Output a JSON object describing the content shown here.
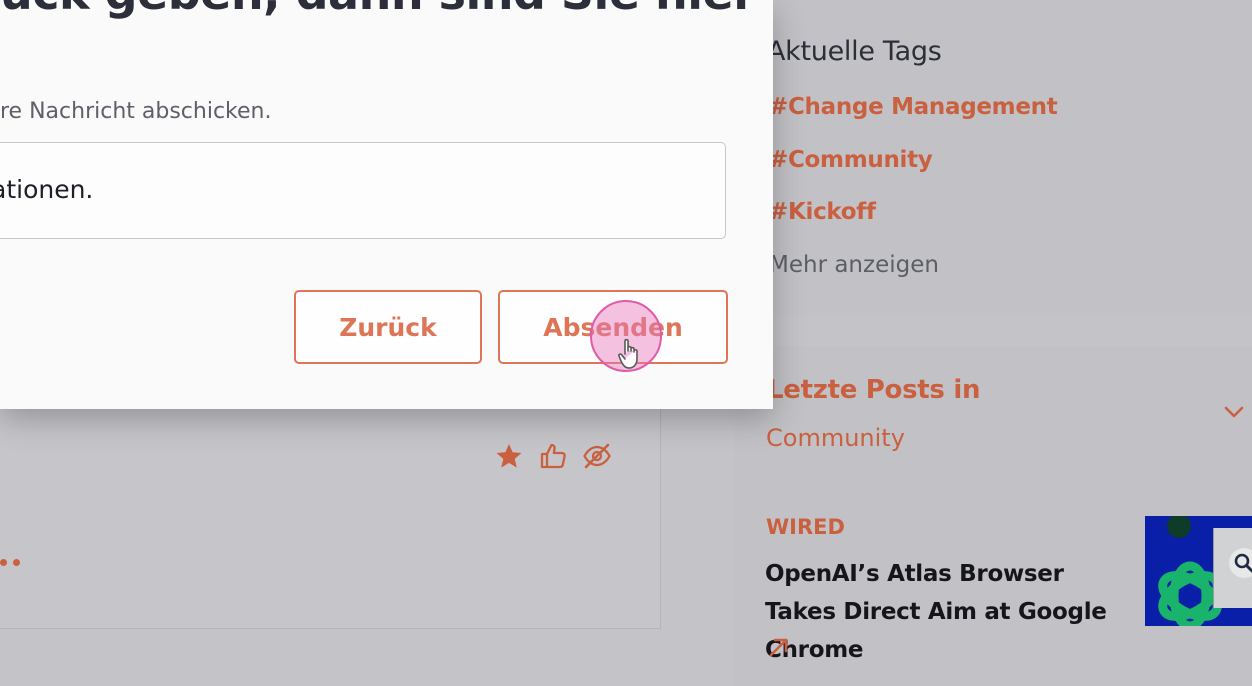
{
  "modal": {
    "heading": "ück geben, dann sind Sie hier",
    "description": "re Nachricht abschicken.",
    "input_value": "ationen.",
    "back_label": "Zurück",
    "send_label": "Absenden"
  },
  "sidebar": {
    "tags_title": "Aktuelle Tags",
    "tags": [
      "#Change Management",
      "#Community",
      "#Kickoff"
    ],
    "more_label": "Mehr anzeigen",
    "posts_title": "Letzte Posts in",
    "posts_subtitle": "Community",
    "post": {
      "source": "WIRED",
      "title": "OpenAI’s Atlas Browser Takes Direct Aim at Google Chrome"
    }
  },
  "icons": {
    "feed_actions": [
      "star-icon",
      "thumbs-up-icon",
      "eye-slash-icon"
    ],
    "chevron": "chevron-down-icon",
    "external": "arrow-up-right-icon",
    "cursor": "hand-pointer-icon"
  },
  "colors": {
    "accent": "#de7556",
    "accent_dim": "#c9603f",
    "overlay_bg": "#c4c4c8",
    "modal_bg": "#fafafa"
  }
}
